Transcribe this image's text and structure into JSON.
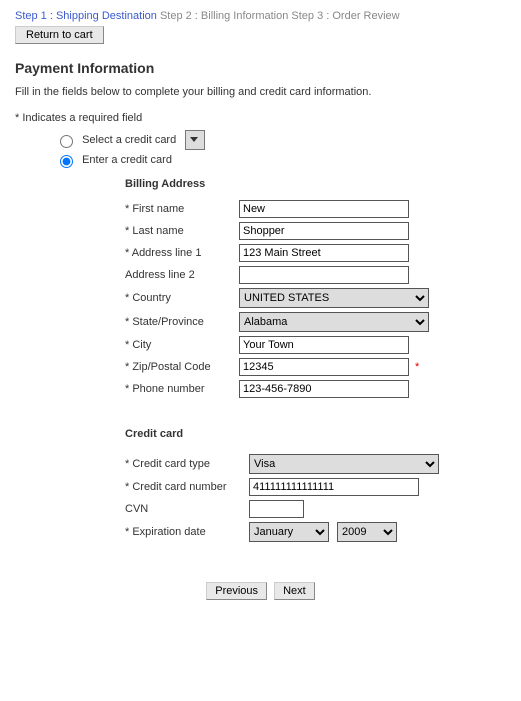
{
  "steps": {
    "s1": "Step 1 : Shipping Destination",
    "s2": "Step 2 : Billing Information",
    "s3": "Step 3 : Order Review"
  },
  "return_btn": "Return to cart",
  "title": "Payment Information",
  "instruction": "Fill in the fields below to complete your billing and credit card information.",
  "required_note": "* Indicates a required field",
  "radios": {
    "select_card": "Select a credit card",
    "enter_card": "Enter a credit card"
  },
  "billing_heading": "Billing Address",
  "labels": {
    "first_name": "* First name",
    "last_name": "* Last name",
    "addr1": "* Address line 1",
    "addr2": "Address line 2",
    "country": "* Country",
    "state": "* State/Province",
    "city": "* City",
    "zip": "* Zip/Postal Code",
    "phone": "* Phone number"
  },
  "values": {
    "first_name": "New",
    "last_name": "Shopper",
    "addr1": "123 Main Street",
    "addr2": "",
    "country": "UNITED STATES",
    "state": "Alabama",
    "city": "Your Town",
    "zip": "12345",
    "phone": "123-456-7890"
  },
  "cc_heading": "Credit card",
  "cc_labels": {
    "type": "* Credit card type",
    "number": "* Credit card number",
    "cvn": "CVN",
    "exp": "* Expiration date"
  },
  "cc_values": {
    "type": "Visa",
    "number": "411111111111111",
    "cvn": "",
    "month": "January",
    "year": "2009"
  },
  "actions": {
    "prev": "Previous",
    "next": "Next"
  },
  "required_marker": "*"
}
